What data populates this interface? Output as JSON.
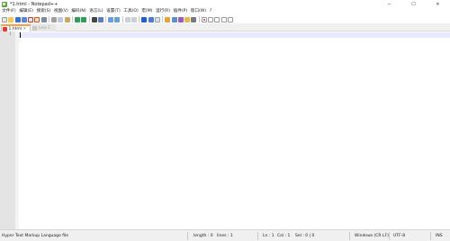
{
  "window": {
    "title": "*1.html - Notepad++",
    "controls": {
      "minimize": "─",
      "maximize": "☐",
      "close": "✕"
    }
  },
  "menu": {
    "items": [
      "文件(F)",
      "编辑(E)",
      "搜索(S)",
      "视图(V)",
      "编码(N)",
      "语言(L)",
      "设置(T)",
      "工具(O)",
      "宏(M)",
      "运行(R)",
      "插件(P)",
      "窗口(W)",
      "?"
    ]
  },
  "toolbar": {
    "icons": [
      "new-file-icon",
      "open-file-icon",
      "save-icon",
      "save-all-icon",
      "close-icon",
      "close-all-icon",
      "print-icon",
      "cut-icon",
      "copy-icon",
      "paste-icon",
      "undo-icon",
      "redo-icon",
      "find-icon",
      "replace-icon",
      "zoom-in-icon",
      "zoom-out-icon",
      "sync-vertical-icon",
      "sync-horizontal-icon",
      "word-wrap-icon",
      "show-all-chars-icon",
      "indent-guide-icon",
      "udl-icon",
      "doc-map-icon",
      "function-list-icon",
      "folder-workspace-icon",
      "monitoring-icon",
      "record-macro-icon",
      "stop-macro-icon",
      "play-macro-icon",
      "play-multiple-icon",
      "save-macro-icon"
    ]
  },
  "tabs": [
    {
      "label": "1.html",
      "close": "✕",
      "active": true
    },
    {
      "label": "new 1",
      "close": "✕",
      "active": false
    }
  ],
  "editor": {
    "line_numbers": [
      "1"
    ]
  },
  "status": {
    "file_type": "Hyper Text Markup Language file",
    "length": "length : 0",
    "lines": "lines : 1",
    "ln": "Ln : 1",
    "col": "Col : 1",
    "sel": "Sel : 0 | 0",
    "eol": "Windows (CR LF)",
    "encoding": "UTF-8",
    "mode": "INS"
  },
  "colors": {
    "tab_accent": "#f7a13e",
    "current_line": "#e8e8ff",
    "gutter": "#e4e4e4"
  }
}
